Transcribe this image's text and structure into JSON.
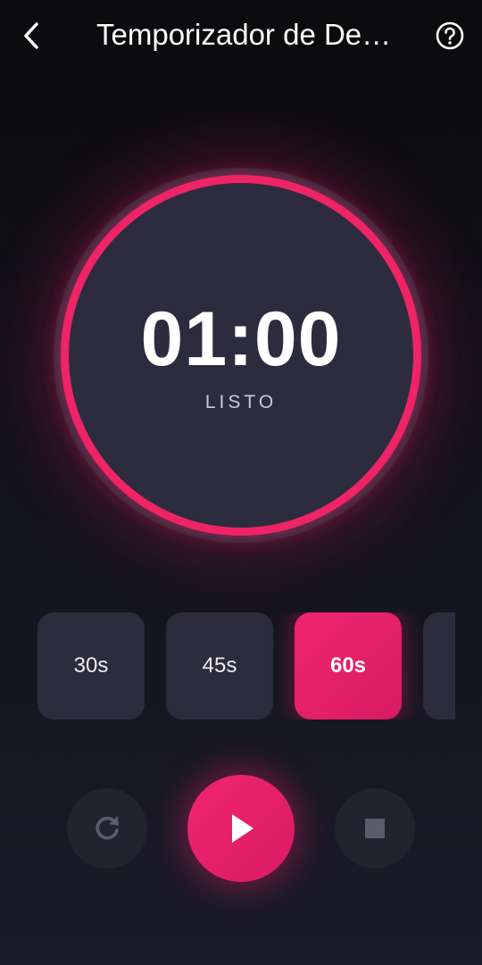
{
  "header": {
    "title": "Temporizador de Des…",
    "back_icon": "chevron-left-icon",
    "help_icon": "help-circle-icon"
  },
  "timer": {
    "time": "01:00",
    "status": "LISTO",
    "progress": 1.0
  },
  "presets": [
    {
      "label": "30s",
      "selected": false
    },
    {
      "label": "45s",
      "selected": false
    },
    {
      "label": "60s",
      "selected": true
    },
    {
      "label": "",
      "selected": false
    }
  ],
  "controls": {
    "reset_icon": "refresh-icon",
    "play_icon": "play-icon",
    "stop_icon": "stop-icon"
  },
  "colors": {
    "accent": "#ee2466",
    "surface": "#2d2c3e",
    "background": "#0b0b0e"
  }
}
